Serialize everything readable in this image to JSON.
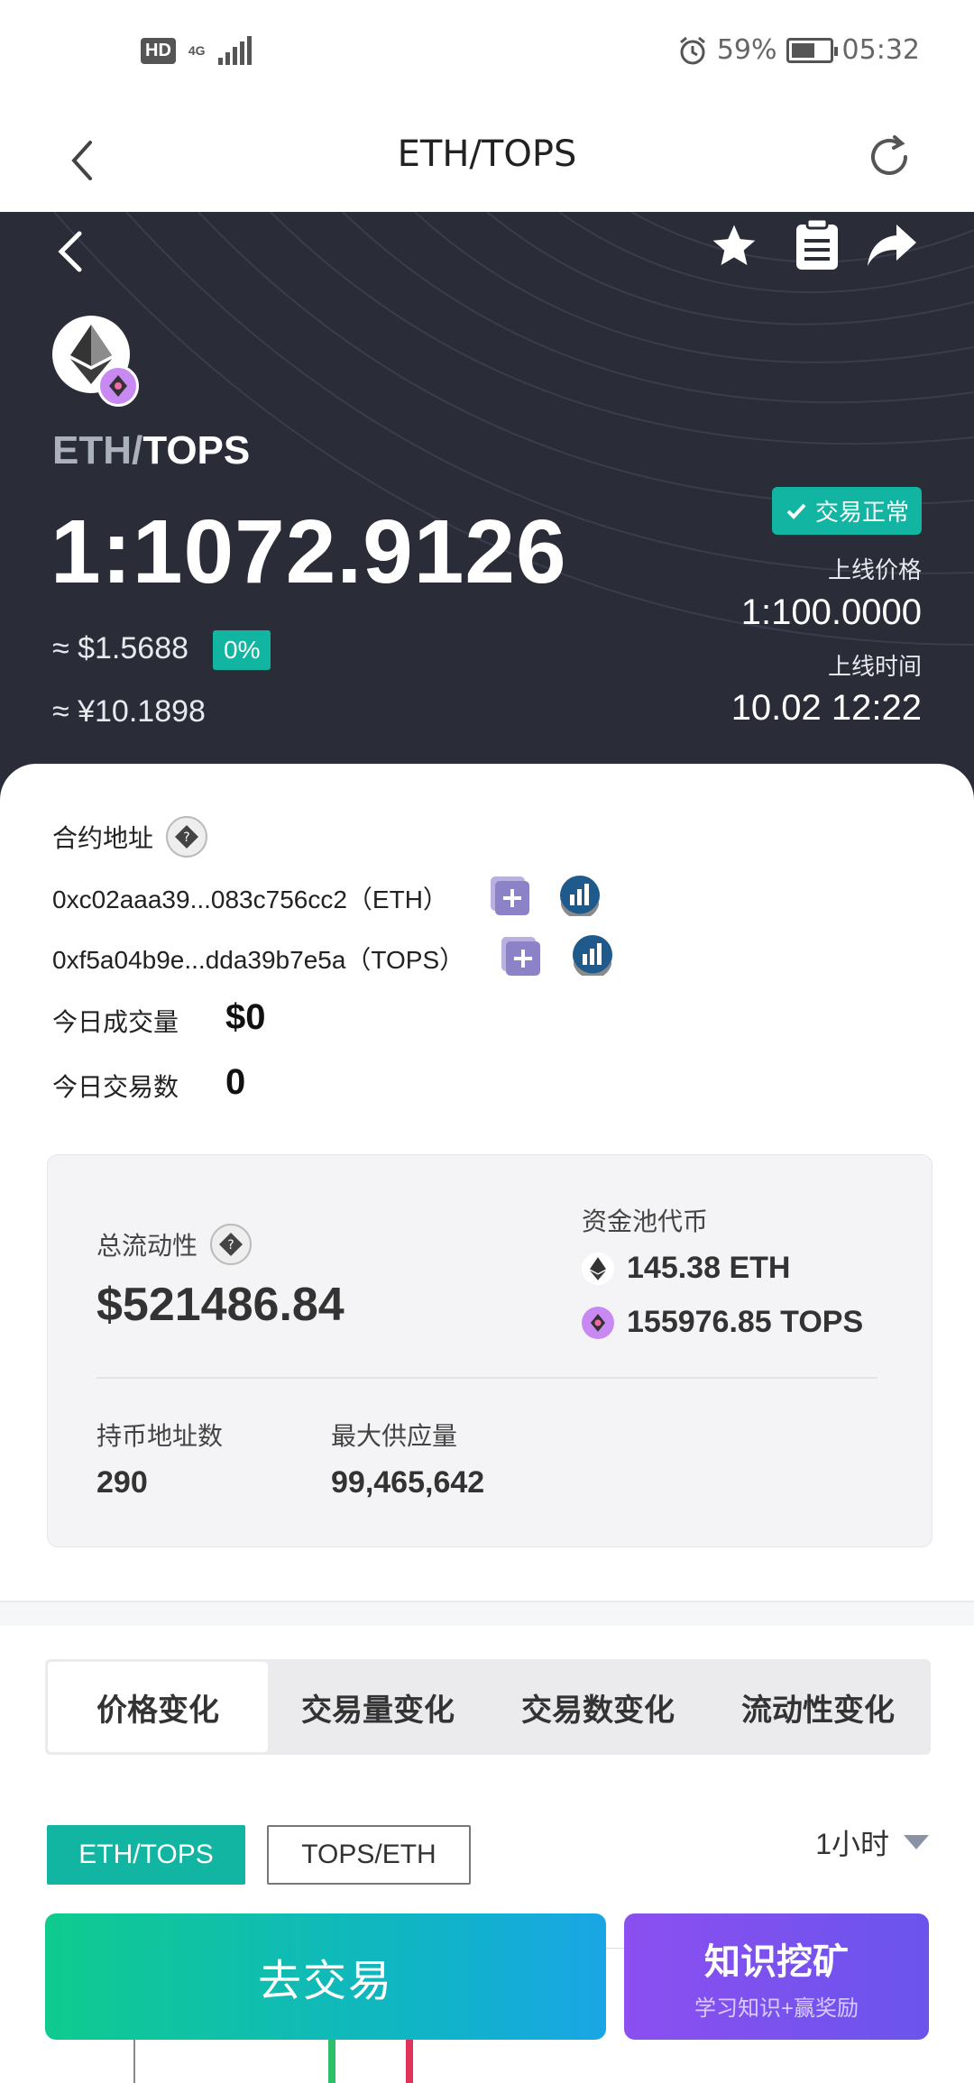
{
  "status_bar": {
    "hd": "HD",
    "network": "4G",
    "battery_text": "59%",
    "time": "05:32"
  },
  "header": {
    "title": "ETH/TOPS"
  },
  "hero": {
    "pair_base": "ETH/",
    "pair_quote": "TOPS",
    "price": "1:1072.9126",
    "usd": "≈ $1.5688",
    "change": "0%",
    "cny": "≈ ¥10.1898",
    "status": "交易正常",
    "launch_price_label": "上线价格",
    "launch_price": "1:100.0000",
    "launch_time_label": "上线时间",
    "launch_time": "10.02 12:22"
  },
  "contract": {
    "label": "合约地址",
    "eth_address": "0xc02aaa39...083c756cc2（ETH）",
    "tops_address": "0xf5a04b9e...dda39b7e5a（TOPS）"
  },
  "today": {
    "volume_label": "今日成交量",
    "volume": "$0",
    "trades_label": "今日交易数",
    "trades": "0"
  },
  "liquidity": {
    "total_label": "总流动性",
    "total": "$521486.84",
    "pool_label": "资金池代币",
    "eth_amount": "145.38 ETH",
    "tops_amount": "155976.85 TOPS",
    "holders_label": "持币地址数",
    "holders": "290",
    "supply_label": "最大供应量",
    "supply": "99,465,642"
  },
  "tabs": [
    "价格变化",
    "交易量变化",
    "交易数变化",
    "流动性变化"
  ],
  "chart_controls": {
    "pair_on": "ETH/TOPS",
    "pair_off": "TOPS/ETH",
    "interval": "1小时"
  },
  "actions": {
    "trade": "去交易",
    "mine_title": "知识挖矿",
    "mine_sub": "学习知识+赢奖励"
  },
  "colors": {
    "accent": "#12b4a2",
    "hero_bg": "#2a2c38",
    "mine": "#7a52ee"
  }
}
